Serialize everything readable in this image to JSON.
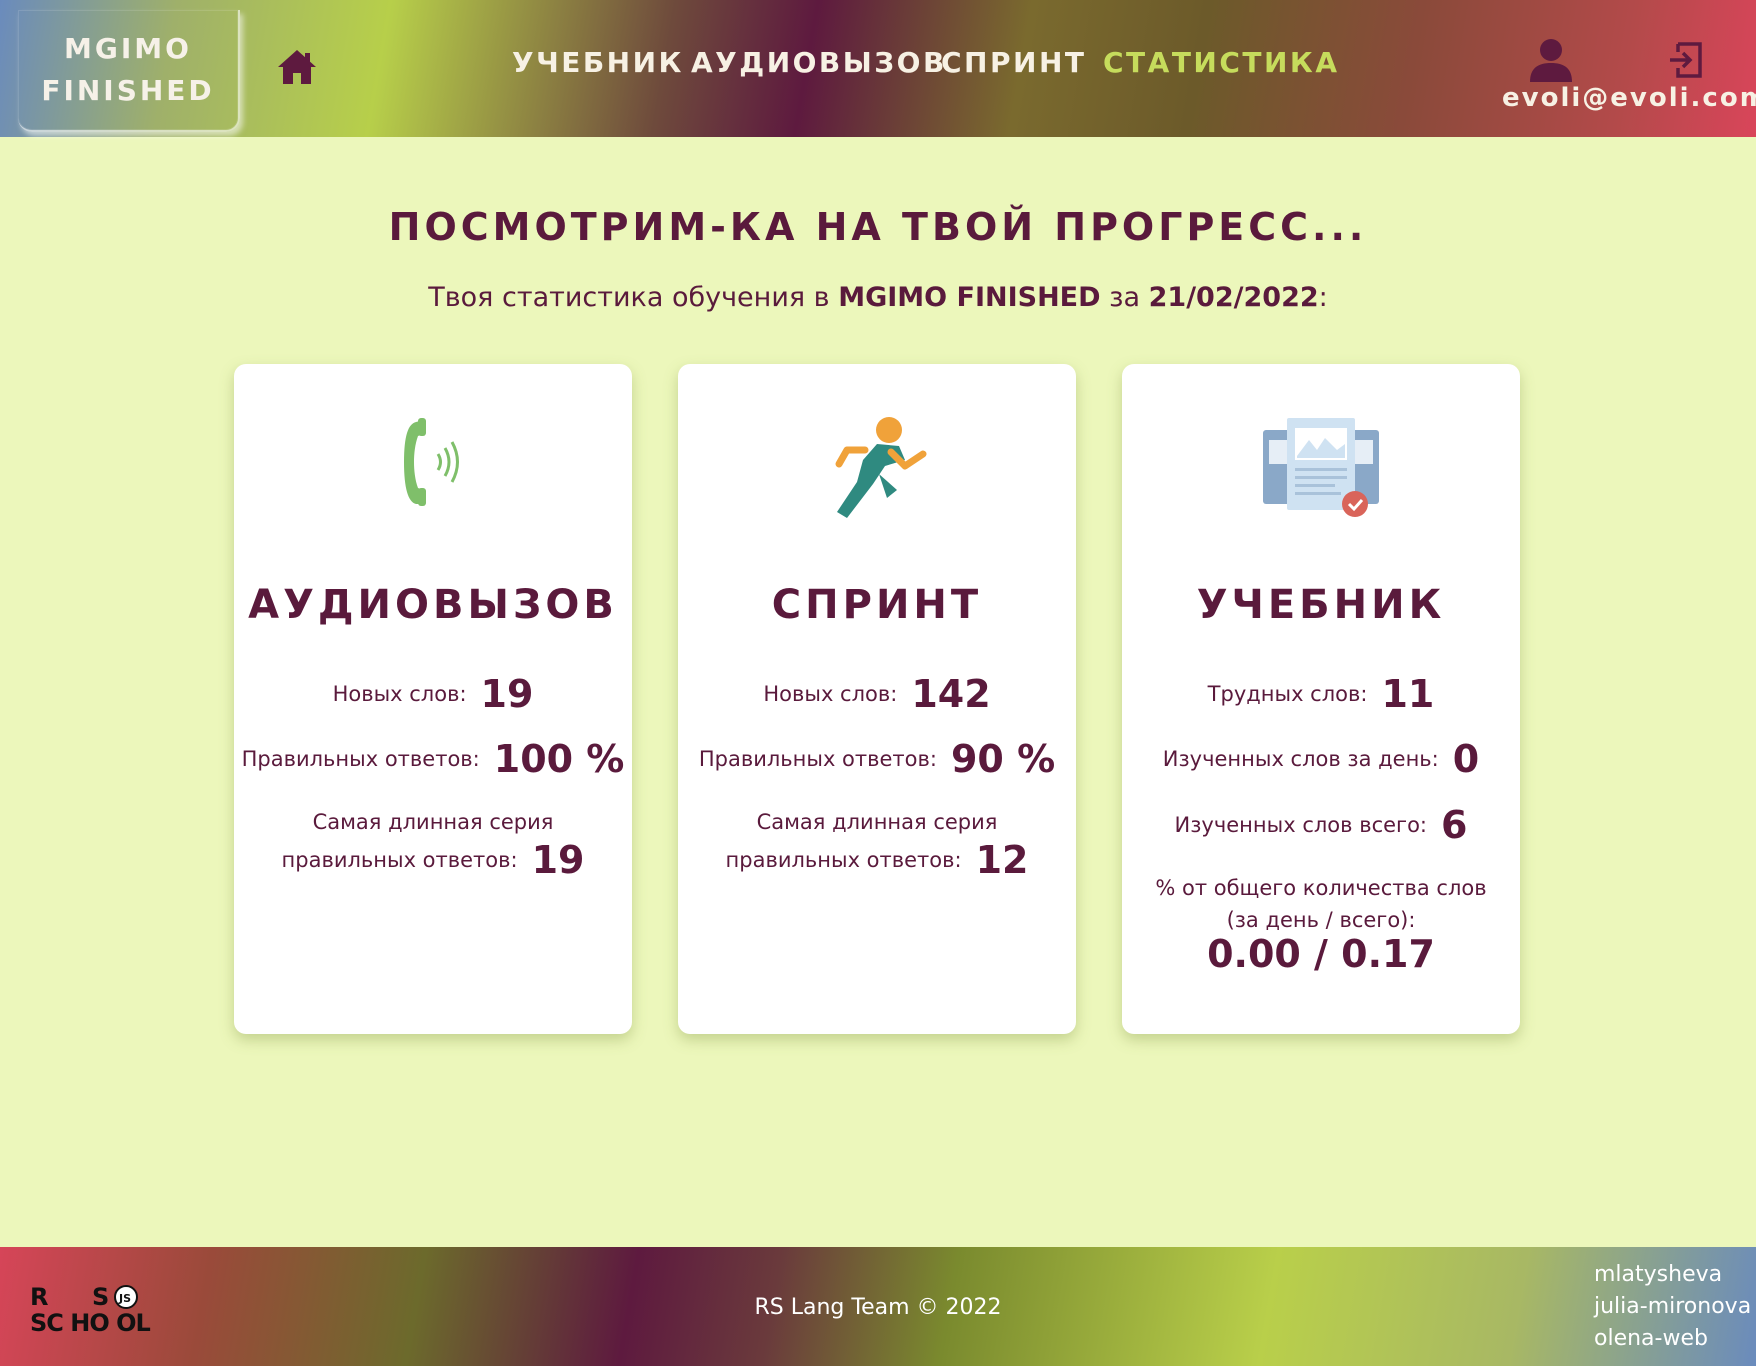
{
  "header": {
    "logo_line1": "MGIMO",
    "logo_line2": "FINISHED",
    "nav": [
      {
        "label": "УЧЕБНИК"
      },
      {
        "label": "АУДИОВЫЗОВ"
      },
      {
        "label": "СПРИНТ"
      },
      {
        "label": "СТАТИСТИКА",
        "active": true
      }
    ],
    "user_email": "evoli@evoli.com",
    "icons": {
      "home": "home-icon",
      "user": "user-icon",
      "logout": "logout-icon"
    },
    "active_color": "#c6dc5c"
  },
  "main": {
    "title": "ПОСМОТРИМ-КА НА ТВОЙ ПРОГРЕСС...",
    "subtitle_prefix": "Твоя статистика обучения в",
    "subtitle_app": "MGIMO FINISHED",
    "subtitle_mid": "за",
    "subtitle_date": "21/02/2022",
    "subtitle_suffix": ":"
  },
  "cards": {
    "audiocall": {
      "icon": "phone-icon",
      "title": "АУДИОВЫЗОВ",
      "new_words_label": "Новых слов:",
      "new_words": "19",
      "correct_label": "Правильных ответов:",
      "correct": "100 %",
      "streak_label1": "Самая длинная серия",
      "streak_label2": "правильных ответов:",
      "streak": "19"
    },
    "sprint": {
      "icon": "runner-icon",
      "title": "СПРИНТ",
      "new_words_label": "Новых слов:",
      "new_words": "142",
      "correct_label": "Правильных ответов:",
      "correct": "90 %",
      "streak_label1": "Самая длинная серия",
      "streak_label2": "правильных ответов:",
      "streak": "12"
    },
    "textbook": {
      "icon": "documents-icon",
      "title": "УЧЕБНИК",
      "hard_label": "Трудных слов:",
      "hard": "11",
      "learned_day_label": "Изученных слов за день:",
      "learned_day": "0",
      "learned_total_label": "Изученных слов всего:",
      "learned_total": "6",
      "percent_label1": "% от общего количества слов",
      "percent_label2": "(за день / всего):",
      "percent": "0.00 / 0.17"
    }
  },
  "footer": {
    "logo": "rs-school-logo",
    "copyright": "RS Lang Team © 2022",
    "authors": [
      "mlatysheva",
      "julia-mironova",
      "olena-web"
    ]
  }
}
